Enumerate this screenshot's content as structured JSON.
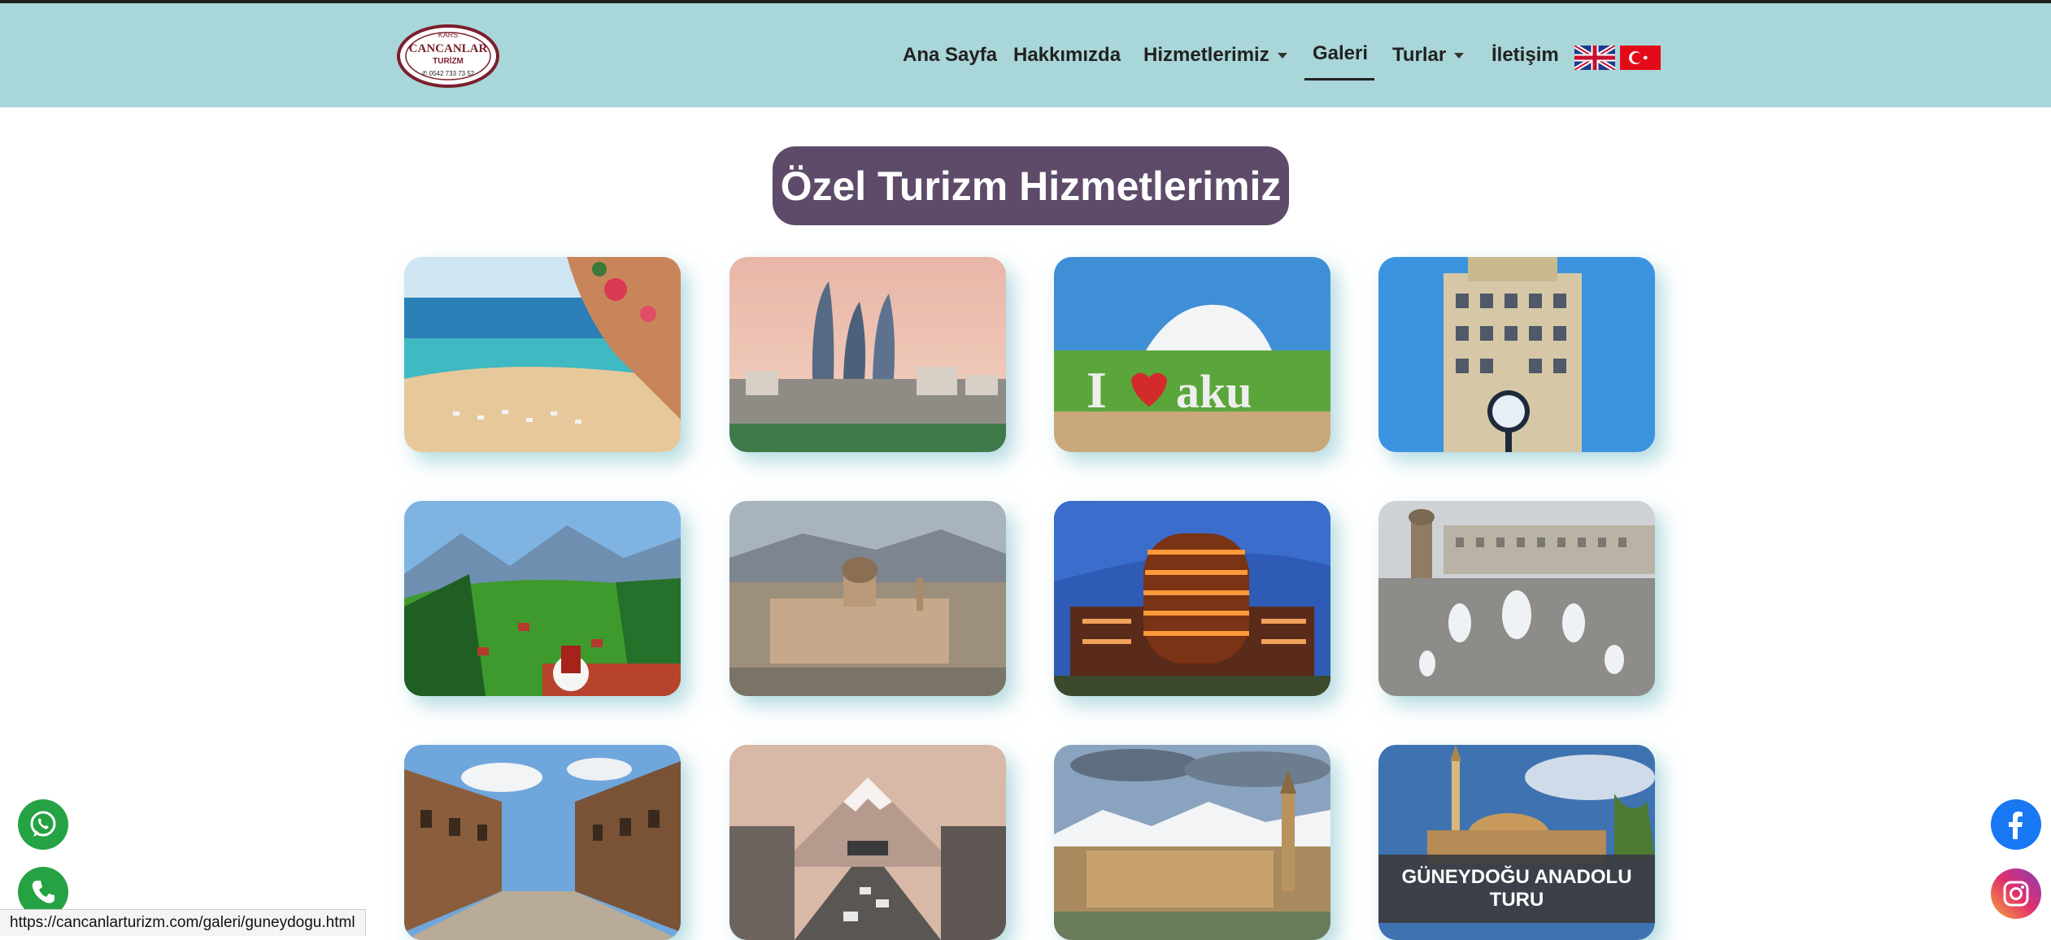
{
  "header": {
    "logo_lines": [
      "KARS",
      "CANCANLAR",
      "TURİZM",
      "0542 733 73 52"
    ],
    "nav": [
      {
        "label": "Ana Sayfa"
      },
      {
        "label": "Hakkımızda"
      },
      {
        "label": "Hizmetlerimiz"
      },
      {
        "label": "Galeri"
      },
      {
        "label": "Turlar"
      },
      {
        "label": "İletişim"
      }
    ],
    "flags": [
      "uk-flag-icon",
      "turkey-flag-icon"
    ]
  },
  "main": {
    "title": "Özel Turizm Hizmetlerimiz",
    "gallery": [
      {
        "image": "beach-cove-photo"
      },
      {
        "image": "baku-flame-towers-photo"
      },
      {
        "image": "i-love-baku-sign-photo"
      },
      {
        "image": "clock-tower-hotel-photo"
      },
      {
        "image": "green-plateau-tea-photo"
      },
      {
        "image": "ishak-pasha-palace-photo"
      },
      {
        "image": "lit-round-building-photo"
      },
      {
        "image": "fountain-square-photo"
      },
      {
        "image": "historic-stone-street-photo"
      },
      {
        "image": "mountain-avenue-photo"
      },
      {
        "image": "mosque-snowy-mountains-photo"
      },
      {
        "image": "southeast-anatolia-mosque-photo",
        "caption": "GÜNEYDOĞU ANADOLU TURU"
      }
    ]
  },
  "floating": [
    "whatsapp-icon",
    "phone-icon",
    "facebook-icon",
    "instagram-icon"
  ],
  "status_bar": {
    "url": "https://cancanlarturizm.com/galeri/guneydogu.html"
  },
  "colors": {
    "navbar": "#a9d6d8",
    "title_pill": "#5d4b69",
    "whatsapp": "#25a244",
    "facebook": "#1877f2"
  }
}
